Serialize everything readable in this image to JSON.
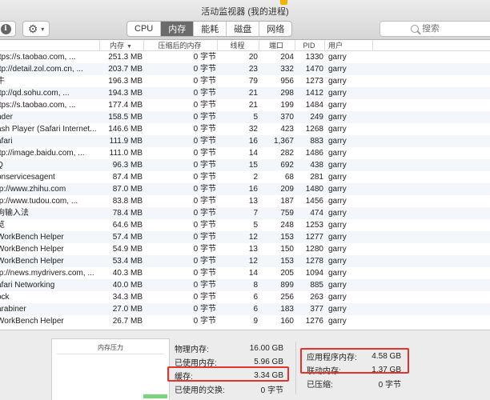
{
  "window": {
    "title": "活动监视器 (我的进程)"
  },
  "toolbar": {
    "info_icon": "i",
    "gear_icon": "gear-icon",
    "tabs": [
      {
        "label": "CPU",
        "active": false
      },
      {
        "label": "内存",
        "active": true
      },
      {
        "label": "能耗",
        "active": false
      },
      {
        "label": "磁盘",
        "active": false
      },
      {
        "label": "网络",
        "active": false
      }
    ],
    "search_placeholder": "搜索"
  },
  "table": {
    "columns": {
      "memory": "内存",
      "compressed": "压缩后的内存",
      "threads": "线程",
      "ports": "端口",
      "pid": "PID",
      "user": "用户"
    },
    "rows": [
      {
        "name": "ttps://s.taobao.com, ...",
        "memory": "251.3 MB",
        "compressed": "0 字节",
        "threads": "20",
        "ports": "204",
        "pid": "1330",
        "user": "garry"
      },
      {
        "name": "ttp://detail.zol.com.cn, ...",
        "memory": "203.7 MB",
        "compressed": "0 字节",
        "threads": "23",
        "ports": "332",
        "pid": "1470",
        "user": "garry"
      },
      {
        "name": "牛",
        "memory": "196.3 MB",
        "compressed": "0 字节",
        "threads": "79",
        "ports": "956",
        "pid": "1273",
        "user": "garry"
      },
      {
        "name": "ttp://qd.sohu.com, ...",
        "memory": "194.3 MB",
        "compressed": "0 字节",
        "threads": "21",
        "ports": "298",
        "pid": "1412",
        "user": "garry"
      },
      {
        "name": "ttps://s.taobao.com, ...",
        "memory": "177.4 MB",
        "compressed": "0 字节",
        "threads": "21",
        "ports": "199",
        "pid": "1484",
        "user": "garry"
      },
      {
        "name": "nder",
        "memory": "158.5 MB",
        "compressed": "0 字节",
        "threads": "5",
        "ports": "370",
        "pid": "249",
        "user": "garry"
      },
      {
        "name": "ash Player (Safari Internet...",
        "memory": "146.6 MB",
        "compressed": "0 字节",
        "threads": "32",
        "ports": "423",
        "pid": "1268",
        "user": "garry"
      },
      {
        "name": "afari",
        "memory": "111.9 MB",
        "compressed": "0 字节",
        "threads": "16",
        "ports": "1,367",
        "pid": "883",
        "user": "garry"
      },
      {
        "name": "ttp://image.baidu.com, ...",
        "memory": "111.0 MB",
        "compressed": "0 字节",
        "threads": "14",
        "ports": "282",
        "pid": "1486",
        "user": "garry"
      },
      {
        "name": "Q",
        "memory": "96.3 MB",
        "compressed": "0 字节",
        "threads": "15",
        "ports": "692",
        "pid": "438",
        "user": "garry"
      },
      {
        "name": "onservicesagent",
        "memory": "87.4 MB",
        "compressed": "0 字节",
        "threads": "2",
        "ports": "68",
        "pid": "281",
        "user": "garry"
      },
      {
        "name": "tp://www.zhihu.com",
        "memory": "87.0 MB",
        "compressed": "0 字节",
        "threads": "16",
        "ports": "209",
        "pid": "1480",
        "user": "garry"
      },
      {
        "name": "tp://www.tudou.com, ...",
        "memory": "83.8 MB",
        "compressed": "0 字节",
        "threads": "13",
        "ports": "187",
        "pid": "1456",
        "user": "garry"
      },
      {
        "name": "狗输入法",
        "memory": "78.4 MB",
        "compressed": "0 字节",
        "threads": "7",
        "ports": "759",
        "pid": "474",
        "user": "garry"
      },
      {
        "name": "览",
        "memory": "64.6 MB",
        "compressed": "0 字节",
        "threads": "5",
        "ports": "248",
        "pid": "1253",
        "user": "garry"
      },
      {
        "name": "WorkBench Helper",
        "memory": "57.4 MB",
        "compressed": "0 字节",
        "threads": "12",
        "ports": "153",
        "pid": "1277",
        "user": "garry"
      },
      {
        "name": "WorkBench Helper",
        "memory": "54.9 MB",
        "compressed": "0 字节",
        "threads": "13",
        "ports": "150",
        "pid": "1280",
        "user": "garry"
      },
      {
        "name": "WorkBench Helper",
        "memory": "53.4 MB",
        "compressed": "0 字节",
        "threads": "12",
        "ports": "153",
        "pid": "1278",
        "user": "garry"
      },
      {
        "name": "tp://news.mydrivers.com, ...",
        "memory": "40.3 MB",
        "compressed": "0 字节",
        "threads": "14",
        "ports": "205",
        "pid": "1094",
        "user": "garry"
      },
      {
        "name": "afari Networking",
        "memory": "40.0 MB",
        "compressed": "0 字节",
        "threads": "8",
        "ports": "899",
        "pid": "885",
        "user": "garry"
      },
      {
        "name": "ock",
        "memory": "34.3 MB",
        "compressed": "0 字节",
        "threads": "6",
        "ports": "256",
        "pid": "263",
        "user": "garry"
      },
      {
        "name": "arabiner",
        "memory": "27.0 MB",
        "compressed": "0 字节",
        "threads": "6",
        "ports": "183",
        "pid": "377",
        "user": "garry"
      },
      {
        "name": "WorkBench Helper",
        "memory": "26.7 MB",
        "compressed": "0 字节",
        "threads": "9",
        "ports": "160",
        "pid": "1276",
        "user": "garry"
      }
    ]
  },
  "summary": {
    "pressure_title": "内存压力",
    "physical_label": "物理内存:",
    "physical_value": "16.00 GB",
    "used_label": "已使用内存:",
    "used_value": "5.96 GB",
    "cache_label": "缓存:",
    "cache_value": "3.34 GB",
    "swap_label": "已使用的交换:",
    "swap_value": "0 字节",
    "app_label": "应用程序内存:",
    "app_value": "4.58 GB",
    "wired_label": "联动内存:",
    "wired_value": "1.37 GB",
    "compressed_label": "已压缩:",
    "compressed_value": "0 字节"
  },
  "colors": {
    "highlight": "#e4322d",
    "active_tab": "#6b6b6b",
    "pressure": "#7bd37b"
  }
}
